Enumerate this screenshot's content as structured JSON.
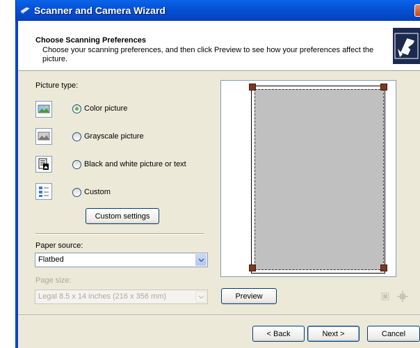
{
  "window": {
    "title": "Scanner and Camera Wizard"
  },
  "header": {
    "title": "Choose Scanning Preferences",
    "subtitle": "Choose your scanning preferences, and then click Preview to see how your preferences affect the picture."
  },
  "picture_type": {
    "label": "Picture type:",
    "options": [
      {
        "label": "Color picture",
        "selected": true,
        "icon": "color-picture-icon"
      },
      {
        "label": "Grayscale picture",
        "selected": false,
        "icon": "grayscale-picture-icon"
      },
      {
        "label": "Black and white picture or text",
        "selected": false,
        "icon": "bw-picture-text-icon"
      },
      {
        "label": "Custom",
        "selected": false,
        "icon": "custom-settings-icon"
      }
    ],
    "custom_settings_button": "Custom settings"
  },
  "paper_source": {
    "label": "Paper source:",
    "value": "Flatbed"
  },
  "page_size": {
    "label": "Page size:",
    "value": "Legal 8.5 x 14 inches (216 x 356 mm)"
  },
  "preview_button": "Preview",
  "footer": {
    "back": "< Back",
    "next": "Next >",
    "cancel": "Cancel"
  },
  "colors": {
    "title_bar": "#0553d6",
    "dialog_bg": "#ece9d8",
    "scan_area": "#c0c0c0"
  }
}
